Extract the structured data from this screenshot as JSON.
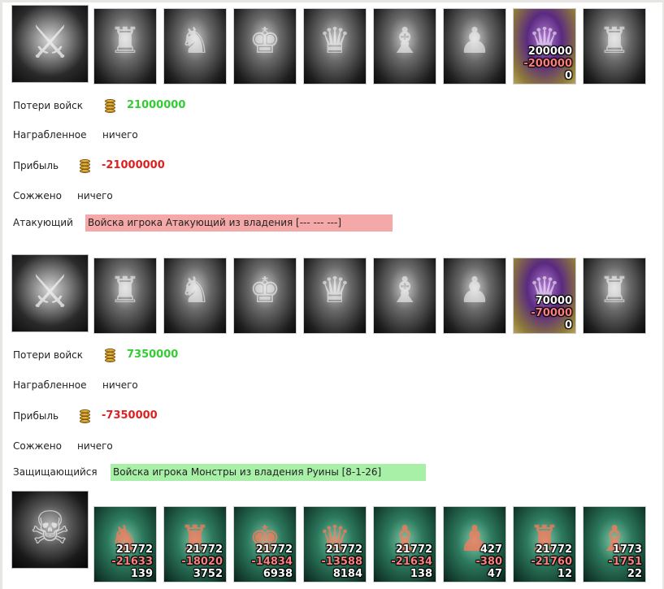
{
  "attack1": {
    "hero_icon": "battle-axe-emblem-icon",
    "units": [
      {
        "icon": "golem-icon",
        "alive": "",
        "lost": "",
        "count": ""
      },
      {
        "icon": "swordsman-icon",
        "alive": "",
        "lost": "",
        "count": ""
      },
      {
        "icon": "knight-icon",
        "alive": "",
        "lost": "",
        "count": ""
      },
      {
        "icon": "griffin-icon",
        "alive": "",
        "lost": "",
        "count": ""
      },
      {
        "icon": "archer-icon",
        "alive": "",
        "lost": "",
        "count": ""
      },
      {
        "icon": "dark-mage-icon",
        "alive": "",
        "lost": "",
        "count": ""
      },
      {
        "icon": "purple-sorcerer-icon",
        "alive": "200000",
        "lost": "-200000",
        "count": "0"
      },
      {
        "icon": "spider-knight-icon",
        "alive": "",
        "lost": "",
        "count": ""
      }
    ],
    "losses_label": "Потери войск",
    "losses_value": "21000000",
    "loot_label": "Награбленное",
    "loot_value": "ничего",
    "profit_label": "Прибыль",
    "profit_value": "-21000000",
    "burned_label": "Сожжено",
    "burned_value": "ничего"
  },
  "attacker": {
    "label": "Атакующий",
    "banner": "Войска игрока Атакующий из владения [--- --- ---]"
  },
  "attack2": {
    "hero_icon": "battle-axe-emblem-icon",
    "units": [
      {
        "icon": "golem-icon",
        "alive": "",
        "lost": "",
        "count": ""
      },
      {
        "icon": "swordsman-icon",
        "alive": "",
        "lost": "",
        "count": ""
      },
      {
        "icon": "knight-icon",
        "alive": "",
        "lost": "",
        "count": ""
      },
      {
        "icon": "griffin-icon",
        "alive": "",
        "lost": "",
        "count": ""
      },
      {
        "icon": "archer-icon",
        "alive": "",
        "lost": "",
        "count": ""
      },
      {
        "icon": "dark-mage-icon",
        "alive": "",
        "lost": "",
        "count": ""
      },
      {
        "icon": "purple-sorcerer-icon",
        "alive": "70000",
        "lost": "-70000",
        "count": "0"
      },
      {
        "icon": "spider-knight-icon",
        "alive": "",
        "lost": "",
        "count": ""
      }
    ],
    "losses_label": "Потери войск",
    "losses_value": "7350000",
    "loot_label": "Награбленное",
    "loot_value": "ничего",
    "profit_label": "Прибыль",
    "profit_value": "-7350000",
    "burned_label": "Сожжено",
    "burned_value": "ничего"
  },
  "defender": {
    "label": "Защищающийся",
    "banner": "Войска игрока Монстры из владения Руины [8-1-26]",
    "hero_icon": "demon-mask-icon",
    "units": [
      {
        "icon": "lizardman-icon",
        "alive": "21772",
        "lost": "-21633",
        "count": "139"
      },
      {
        "icon": "armored-ogre-icon",
        "alive": "21772",
        "lost": "-18020",
        "count": "3752"
      },
      {
        "icon": "orc-warrior-icon",
        "alive": "21772",
        "lost": "-14834",
        "count": "6938"
      },
      {
        "icon": "red-demon-icon",
        "alive": "21772",
        "lost": "-13588",
        "count": "8184"
      },
      {
        "icon": "bone-claw-icon",
        "alive": "21772",
        "lost": "-21634",
        "count": "138"
      },
      {
        "icon": "red-imp-icon",
        "alive": "427",
        "lost": "-380",
        "count": "47"
      },
      {
        "icon": "iron-golem-icon",
        "alive": "21772",
        "lost": "-21760",
        "count": "12"
      },
      {
        "icon": "naga-icon",
        "alive": "1773",
        "lost": "-1751",
        "count": "22"
      }
    ]
  }
}
